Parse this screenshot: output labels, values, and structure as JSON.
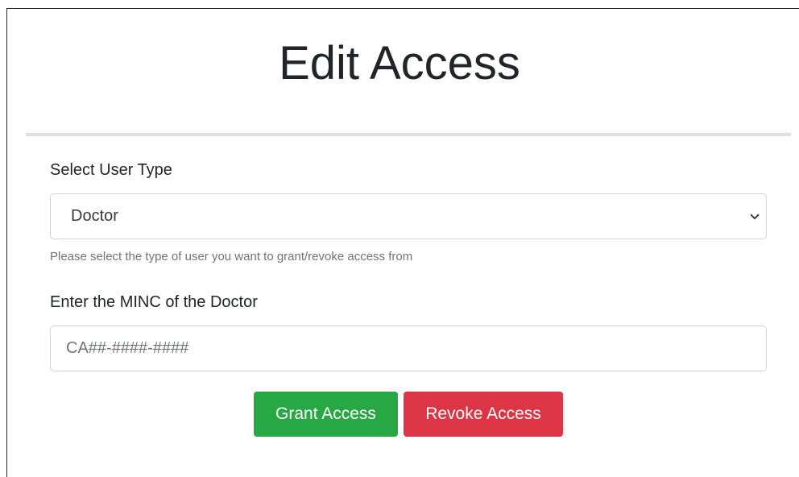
{
  "page": {
    "title": "Edit Access"
  },
  "form": {
    "user_type": {
      "label": "Select User Type",
      "selected_value": "Doctor",
      "help_text": "Please select the type of user you want to grant/revoke access from",
      "icon": "chevron-down-icon"
    },
    "minc": {
      "label": "Enter the MINC of the Doctor",
      "value": "",
      "placeholder": "CA##-####-####"
    }
  },
  "actions": {
    "grant_label": "Grant Access",
    "revoke_label": "Revoke Access"
  },
  "colors": {
    "grant": "#28a745",
    "revoke": "#dc3545",
    "divider": "#dfe0e1",
    "help_text": "#6c757d"
  }
}
